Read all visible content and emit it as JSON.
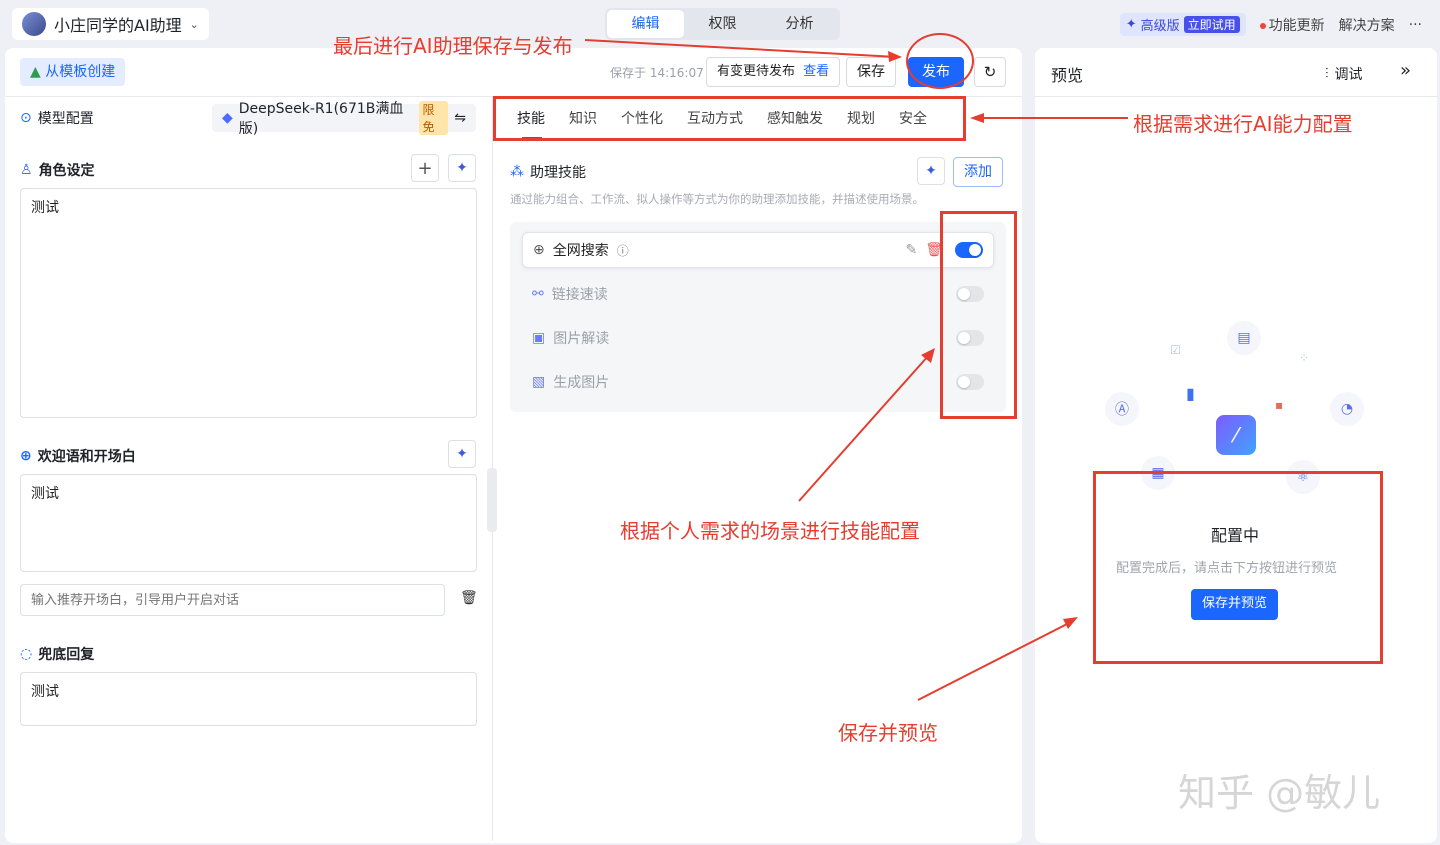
{
  "header": {
    "app_name": "小庄同学的AI助理",
    "mode_tabs": [
      "编辑",
      "权限",
      "分析"
    ],
    "pro_label": "高级版",
    "pro_trial": "立即试用",
    "updates": "功能更新",
    "solutions": "解决方案",
    "more": "···"
  },
  "toolbar": {
    "template_btn": "从模板创建",
    "saved_at": "保存于 14:16:07",
    "pending_text": "有变更待发布",
    "pending_link": "查看",
    "save": "保存",
    "publish": "发布"
  },
  "left": {
    "model_label": "模型配置",
    "model_name": "DeepSeek-R1(671B满血版)",
    "model_badge": "限免",
    "role_title": "角色设定",
    "role_text": "测试",
    "welcome_title": "欢迎语和开场白",
    "welcome_text": "测试",
    "opener_placeholder": "输入推荐开场白，引导用户开启对话",
    "fallback_title": "兜底回复",
    "fallback_text": "测试"
  },
  "middle": {
    "tabs": [
      "技能",
      "知识",
      "个性化",
      "互动方式",
      "感知触发",
      "规划",
      "安全"
    ],
    "skills_title": "助理技能",
    "add_btn": "添加",
    "skills_desc": "通过能力组合、工作流、拟人操作等方式为你的助理添加技能，并描述使用场景。",
    "skills": [
      {
        "name": "全网搜索",
        "on": true
      },
      {
        "name": "链接速读",
        "on": false
      },
      {
        "name": "图片解读",
        "on": false
      },
      {
        "name": "生成图片",
        "on": false
      }
    ]
  },
  "preview": {
    "title": "预览",
    "debug": "调试",
    "status_title": "配置中",
    "status_desc": "配置完成后，请点击下方按钮进行预览",
    "save_preview_btn": "保存并预览"
  },
  "annotations": {
    "publish_note": "最后进行AI助理保存与发布",
    "ability_note": "根据需求进行AI能力配置",
    "skill_note": "根据个人需求的场景进行技能配置",
    "preview_note": "保存并预览"
  },
  "watermark": "知乎 @敏儿",
  "colors": {
    "accent": "#1a66ff",
    "annotation": "#e53d30"
  }
}
